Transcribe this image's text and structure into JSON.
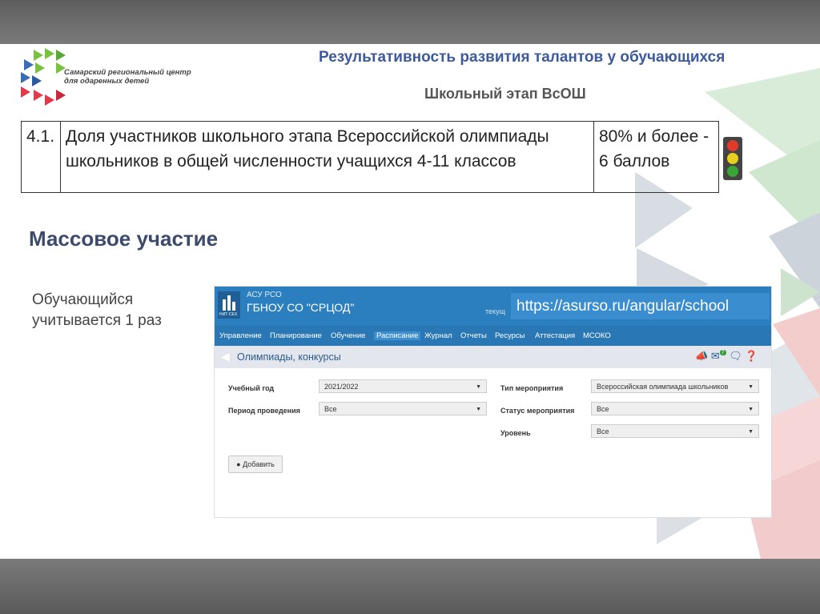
{
  "logo": {
    "line1": "Самарский региональный центр",
    "line2": "для одаренных детей"
  },
  "slide": {
    "title": "Результативность развития талантов у обучающихся",
    "subtitle": "Школьный этап ВсОШ"
  },
  "criterion": {
    "number": "4.1.",
    "text": "Доля участников школьного этапа Всероссийской олимпиады школьников в общей численности учащихся 4-11 классов",
    "value": "80% и более - 6 баллов"
  },
  "traffic_light": {
    "colors": [
      "#e23a2a",
      "#e6d21e",
      "#3aa636"
    ]
  },
  "section": {
    "title": "Массовое участие",
    "note": "Обучающийся учитывается 1 раз"
  },
  "app": {
    "system": "АСУ РСО",
    "org": "ГБНОУ СО \"СРЦОД\"",
    "logo_text": "НИТ-СЕХ",
    "url_label": "текущ",
    "url": "https://asurso.ru/angular/school",
    "nav": [
      "Управление",
      "Планирование",
      "Обучение",
      "Расписание",
      "Журнал",
      "Отчеты",
      "Ресурсы",
      "Аттестация",
      "МСОКО"
    ],
    "page_title": "Олимпиады, конкурсы",
    "badge": "7",
    "filters": {
      "year_label": "Учебный год",
      "year_value": "2021/2022",
      "period_label": "Период проведения",
      "period_value": "Все",
      "type_label": "Тип мероприятия",
      "type_value": "Всероссийская олимпиада школьников",
      "status_label": "Статус мероприятия",
      "status_value": "Все",
      "level_label": "Уровень",
      "level_value": "Все"
    },
    "add_button": "Добавить"
  }
}
